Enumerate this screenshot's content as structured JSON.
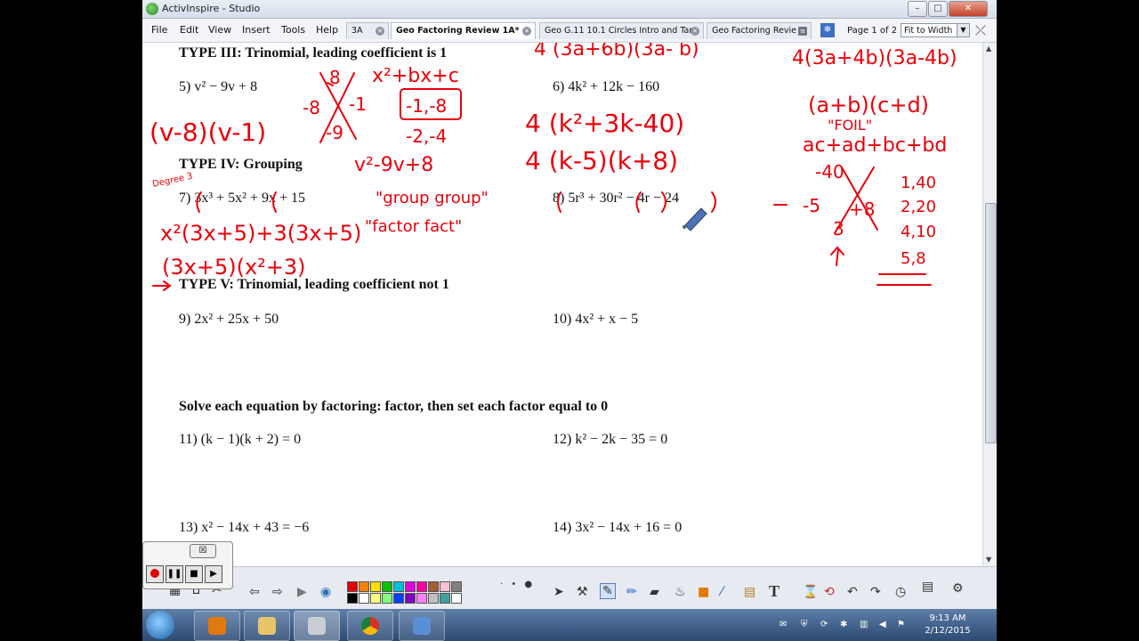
{
  "window": {
    "title": "ActivInspire - Studio"
  },
  "menu": [
    "File",
    "Edit",
    "View",
    "Insert",
    "Tools",
    "Help"
  ],
  "tabs": [
    {
      "label": "3A",
      "active": false
    },
    {
      "label": "Geo Factoring Review 1A*",
      "active": true
    },
    {
      "label": "Geo G.11 10.1 Circles Intro and Tan",
      "active": false
    },
    {
      "label": "Geo Factoring Revie",
      "active": false
    }
  ],
  "page_info": "Page 1 of 2",
  "zoom": "Fit to Width",
  "document": {
    "heading3": "TYPE III:  Trinomial, leading coefficient is 1",
    "p5": "5)  v² − 9v + 8",
    "p6": "6)  4k² + 12k − 160",
    "heading4": "TYPE IV:  Grouping",
    "p7": "7)  3x³ + 5x² + 9x + 15",
    "p8": "8)  5r³ + 30r² − 4r − 24",
    "heading5": "TYPE V:  Trinomial, leading coefficient not 1",
    "p9": "9)  2x² + 25x + 50",
    "p10": "10)  4x² + x − 5",
    "solve_heading": "Solve each equation by factoring: factor, then set each factor equal to 0",
    "p11": "11)  (k − 1)(k + 2) = 0",
    "p12": "12)  k² − 2k − 35 = 0",
    "p13": "13)  x² − 14x + 43 = −6",
    "p14": "14)  3x² − 14x + 16 = 0"
  },
  "annotations": {
    "color": "#e8000a",
    "top_left": "4 (3a+6b)(3a- b)",
    "top_right": "4(3a+4b)(3a-4b)",
    "p5_x_top": "8",
    "p5_x_left": "-8",
    "p5_x_right": "-1",
    "p5_x_bottom": "-9",
    "p5_form": "x²+bx+c",
    "p5_box": "-1,-8",
    "p5_pair": "-2,-4",
    "p5_answer": "(v-8)(v-1)",
    "p6_step1": "4 (k²+3k-40)",
    "p6_step2": "4 (k-5)(k+8)",
    "foil_top": "(a+b)(c+d)",
    "foil_label": "\"FOIL\"",
    "foil_expand": "ac+ad+bc+bd",
    "x_top": "-40",
    "x_left": "-5",
    "x_right": "+8",
    "x_bottom": "3",
    "factors": [
      "1,40",
      "2,20",
      "4,10",
      "5,8"
    ],
    "p7_note_degree": "Degree 3",
    "p7_copy": "v²-9v+8",
    "p7_group": "\"group group\"",
    "p7_factor": "\"factor fact\"",
    "p7_step": "x²(3x+5)+3(3x+5)",
    "p7_answer": "(3x+5)(x²+3)"
  },
  "recorder": {
    "close": "☒"
  },
  "clock": {
    "time": "9:13 AM",
    "date": "2/12/2015"
  }
}
